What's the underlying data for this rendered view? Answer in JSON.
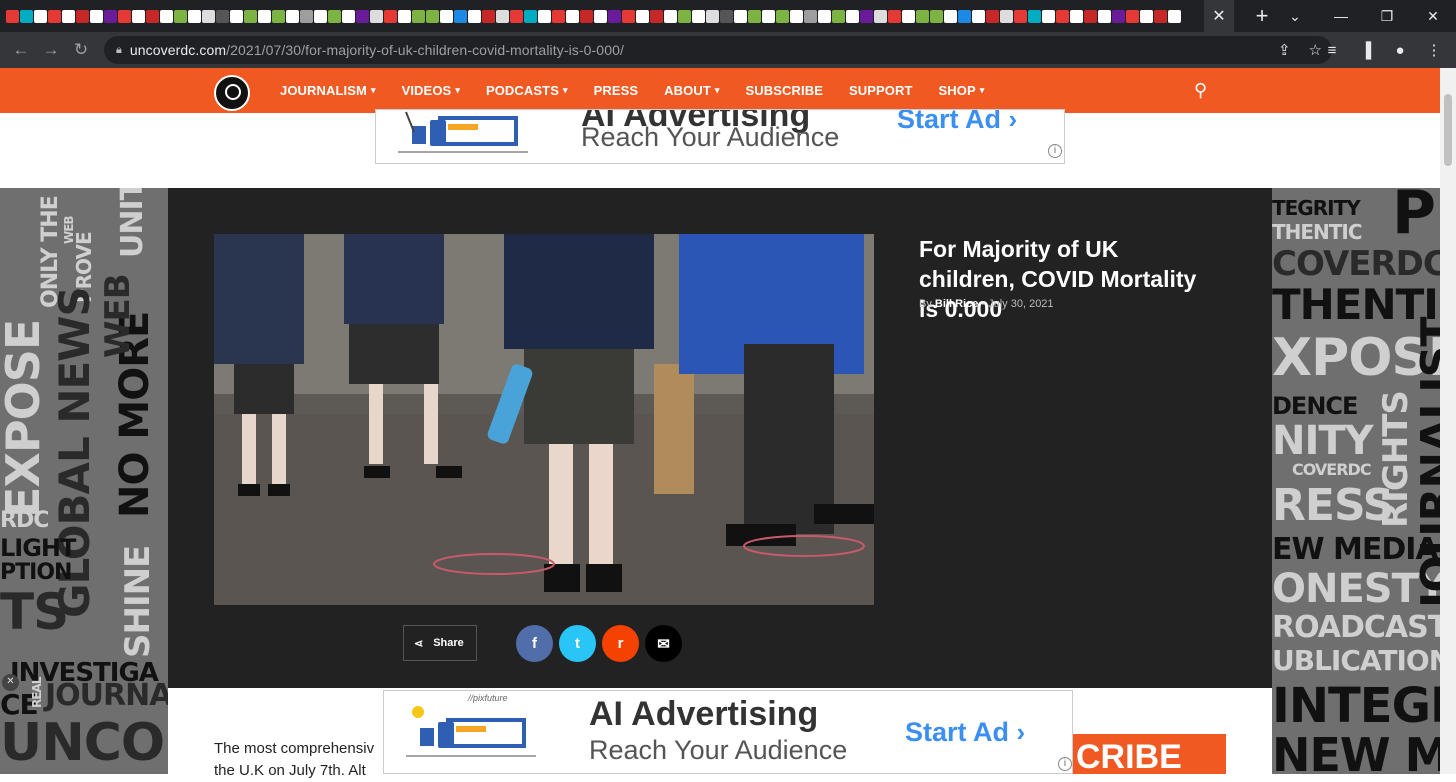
{
  "browser": {
    "url_host": "uncoverdc.com",
    "url_path": "/2021/07/30/for-majority-of-uk-children-covid-mortality-is-0-000/",
    "tab_close": "✕",
    "new_tab": "+",
    "window_min": "—",
    "window_restore": "❐",
    "window_close": "✕"
  },
  "site": {
    "nav": [
      {
        "label": "JOURNALISM",
        "dropdown": true
      },
      {
        "label": "VIDEOS",
        "dropdown": true
      },
      {
        "label": "PODCASTS",
        "dropdown": true
      },
      {
        "label": "PRESS",
        "dropdown": false
      },
      {
        "label": "ABOUT",
        "dropdown": true
      },
      {
        "label": "SUBSCRIBE",
        "dropdown": false
      },
      {
        "label": "SUPPORT",
        "dropdown": false
      },
      {
        "label": "SHOP",
        "dropdown": true
      }
    ],
    "accent": "#f05a22"
  },
  "ads": {
    "top": {
      "line1": "AI Advertising",
      "line2": "Reach Your Audience",
      "cta": "Start Ad"
    },
    "bottom": {
      "brand": "//pixfuture",
      "line1": "AI Advertising",
      "line2": "Reach Your Audience",
      "cta": "Start Ad"
    },
    "info": "i"
  },
  "article": {
    "title": "For Majority of UK children, COVID Mortality is 0.000",
    "by": "By",
    "author": "Bill Rice",
    "separator": "-",
    "date": "July 30, 2021",
    "share_label": "Share",
    "text_line1": "The most comprehensiv",
    "text_line2": "the U.K on July 7th. Alt",
    "subscribe_fragment": "CRIBE"
  },
  "side_words_left": [
    "EXPOSE",
    "ONLY THE",
    "WEB",
    "UNITY",
    "PROVE",
    "GLOBAL NEWS",
    "NO MORE",
    "WEB",
    "RDC",
    "LIGHT",
    "PTION",
    "TS",
    "SHINE",
    "INVESTIGA",
    "CE",
    "REAL",
    "JOURNAL",
    "UNCO"
  ],
  "side_words_right": [
    "TEGRITY",
    "THENTIC",
    "COVERDC",
    "THENTIC",
    "XPOSE",
    "DENCE",
    "NITY",
    "COVERDC",
    "RESS",
    "EW MEDIA",
    "ONESTY",
    "ROADCAST",
    "UBLICATION",
    "INTEGR",
    "NEW ME",
    "RIGHTS",
    "JOURNALIST",
    "PR"
  ],
  "social": [
    {
      "name": "facebook",
      "glyph": "f",
      "color": "#516eab"
    },
    {
      "name": "twitter",
      "glyph": "t",
      "color": "#29c5f6"
    },
    {
      "name": "reddit",
      "glyph": "r",
      "color": "#f54200"
    },
    {
      "name": "email",
      "glyph": "✉",
      "color": "#000000"
    }
  ]
}
